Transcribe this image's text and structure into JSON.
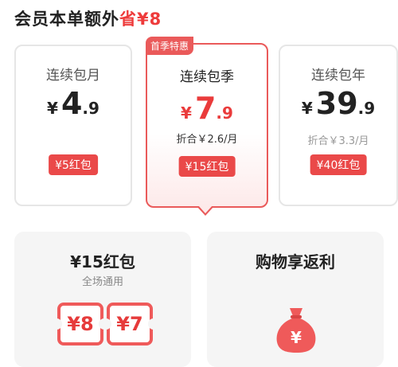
{
  "header": {
    "title": "会员本单额外",
    "highlight": "省¥8"
  },
  "plans": [
    {
      "name": "连续包月",
      "currency": "¥",
      "price_int": "4",
      "price_dec": ".9",
      "note": "",
      "coupon": "¥5红包"
    },
    {
      "name": "连续包季",
      "currency": "¥",
      "price_int": "7",
      "price_dec": ".9",
      "note": "折合￥2.6/月",
      "coupon": "¥15红包",
      "tag": "首季特惠"
    },
    {
      "name": "连续包年",
      "currency": "¥",
      "price_int": "39",
      "price_dec": ".9",
      "note": "折合￥3.3/月",
      "coupon": "¥40红包"
    }
  ],
  "benefits": {
    "redpacket": {
      "title": "¥15红包",
      "subtitle": "全场通用",
      "coupons": [
        "¥8",
        "¥7"
      ]
    },
    "shopping": {
      "title": "购物享返利",
      "icon": "money-bag-icon"
    }
  },
  "colors": {
    "accent": "#ea4949",
    "selected_border": "#ea5a5a",
    "card_bg": "#f5f5f5"
  }
}
